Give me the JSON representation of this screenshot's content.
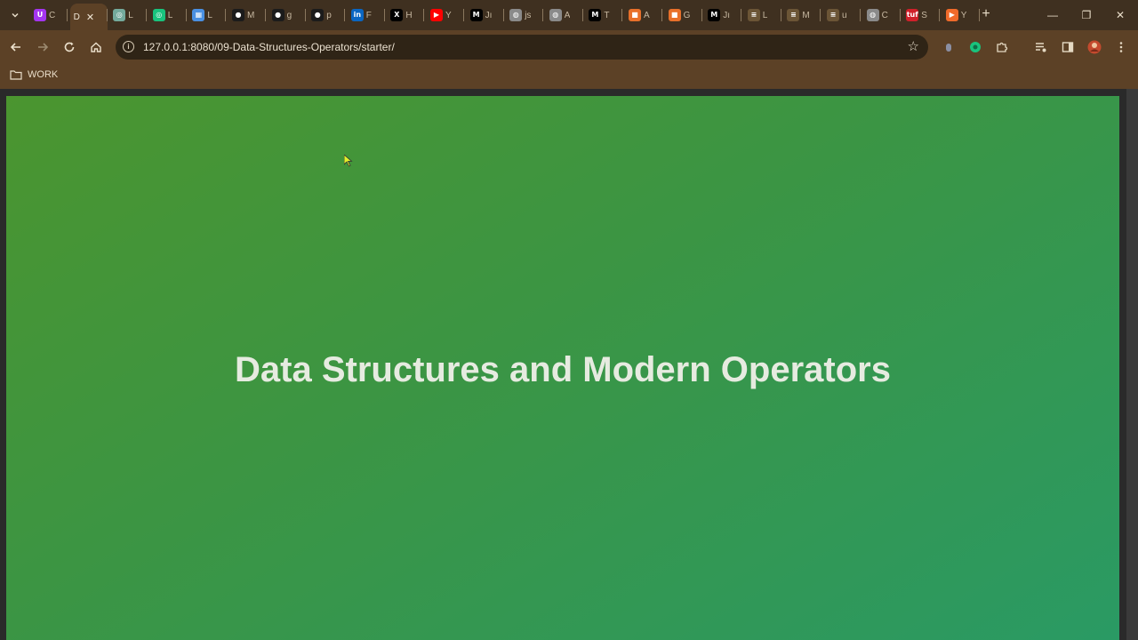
{
  "browser": {
    "tabs": [
      {
        "letter": "C",
        "icon": "udemy-icon",
        "color": "#a435f0",
        "glyph": "U"
      },
      {
        "letter": "D",
        "icon": "page-icon",
        "color": "#5c4126",
        "glyph": "",
        "active": true
      },
      {
        "letter": "L",
        "icon": "chatgpt-icon",
        "color": "#74aa9c",
        "glyph": "◎"
      },
      {
        "letter": "L",
        "icon": "chatgpt-icon",
        "color": "#19c37d",
        "glyph": "◎"
      },
      {
        "letter": "L",
        "icon": "app-icon",
        "color": "#4a90e2",
        "glyph": "▦"
      },
      {
        "letter": "M",
        "icon": "github-icon",
        "color": "#1b1b1b",
        "glyph": "●"
      },
      {
        "letter": "g",
        "icon": "github-icon",
        "color": "#1b1b1b",
        "glyph": "●"
      },
      {
        "letter": "p",
        "icon": "github-icon",
        "color": "#1b1b1b",
        "glyph": "●"
      },
      {
        "letter": "F",
        "icon": "linkedin-icon",
        "color": "#0a66c2",
        "glyph": "in"
      },
      {
        "letter": "H",
        "icon": "x-icon",
        "color": "#000000",
        "glyph": "X"
      },
      {
        "letter": "Y",
        "icon": "youtube-icon",
        "color": "#ff0000",
        "glyph": "▶"
      },
      {
        "letter": "Jı",
        "icon": "medium-icon",
        "color": "#000000",
        "glyph": "M"
      },
      {
        "letter": "js",
        "icon": "globe-icon",
        "color": "#8a8a8a",
        "glyph": "◍"
      },
      {
        "letter": "A",
        "icon": "globe-icon",
        "color": "#8a8a8a",
        "glyph": "◍"
      },
      {
        "letter": "T",
        "icon": "medium-icon",
        "color": "#000000",
        "glyph": "M"
      },
      {
        "letter": "A",
        "icon": "box-icon",
        "color": "#e8702a",
        "glyph": "■"
      },
      {
        "letter": "G",
        "icon": "box-icon",
        "color": "#e8702a",
        "glyph": "■"
      },
      {
        "letter": "Jı",
        "icon": "medium-icon",
        "color": "#000000",
        "glyph": "M"
      },
      {
        "letter": "L",
        "icon": "stack-icon",
        "color": "#6b5536",
        "glyph": "≡"
      },
      {
        "letter": "M",
        "icon": "stack-icon",
        "color": "#6b5536",
        "glyph": "≡"
      },
      {
        "letter": "u",
        "icon": "stack-icon",
        "color": "#6b5536",
        "glyph": "≡"
      },
      {
        "letter": "C",
        "icon": "globe-icon",
        "color": "#8a8a8a",
        "glyph": "◍"
      },
      {
        "letter": "S",
        "icon": "tuf-icon",
        "color": "#d0202a",
        "glyph": "tuf"
      },
      {
        "letter": "Y",
        "icon": "play-icon",
        "color": "#f06a2a",
        "glyph": "▶"
      }
    ],
    "address": "127.0.0.1:8080/09-Data-Structures-Operators/starter/",
    "bookmark_folder": "WORK"
  },
  "page": {
    "heading": "Data Structures and Modern Operators"
  },
  "colors": {
    "gradient_start": "#4b952f",
    "gradient_end": "#2a9a64",
    "heading_text": "#e6ebe0"
  }
}
